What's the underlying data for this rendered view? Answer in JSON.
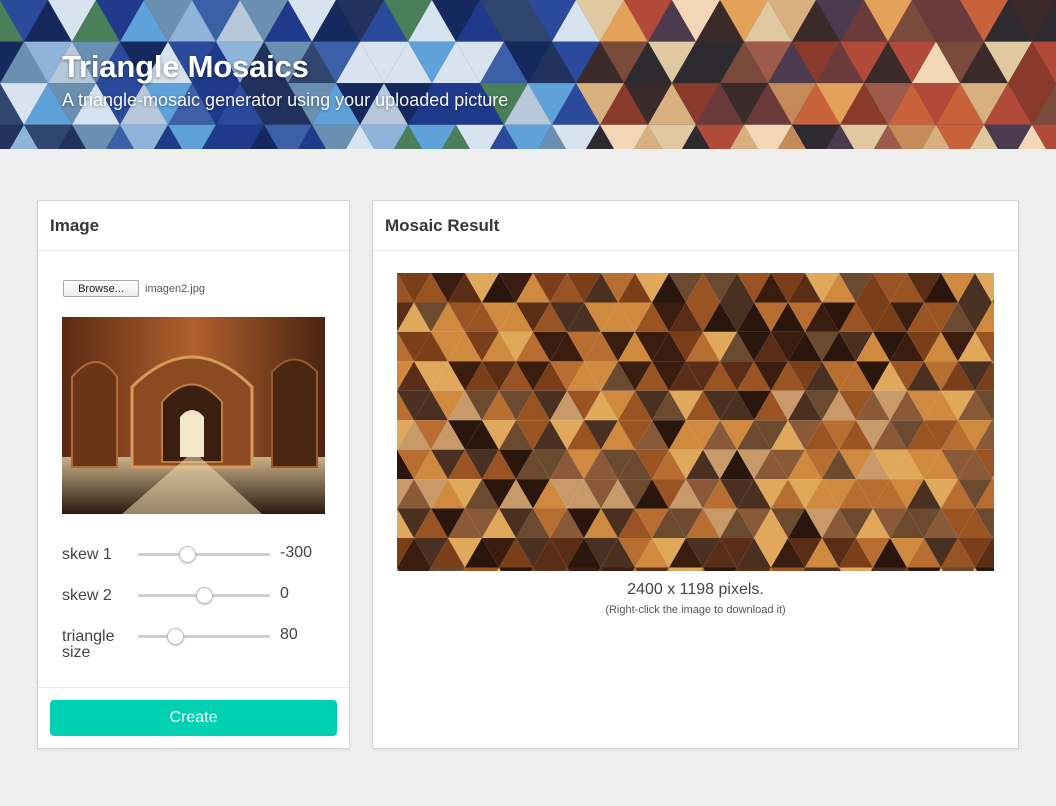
{
  "hero": {
    "title": "Triangle Mosaics",
    "subtitle": "A triangle-mosaic generator using your uploaded picture"
  },
  "image_panel": {
    "header": "Image",
    "browse_label": "Browse...",
    "file_name": "imagen2.jpg",
    "preview_icon": "uploaded-photo",
    "sliders": [
      {
        "label": "skew 1",
        "value": "-300",
        "level": 0.37
      },
      {
        "label": "skew 2",
        "value": "0",
        "level": 0.5
      },
      {
        "label": "triangle size",
        "value": "80",
        "level": 0.28
      }
    ],
    "create_label": "Create"
  },
  "result_panel": {
    "header": "Mosaic Result",
    "size_text": "2400 x 1198 pixels.",
    "hint_text": "(Right-click the image to download it)"
  },
  "colors": {
    "accent": "#00d1b2",
    "background": "#efefef",
    "panel": "#ffffff",
    "hero_base": "#1e2a55"
  }
}
